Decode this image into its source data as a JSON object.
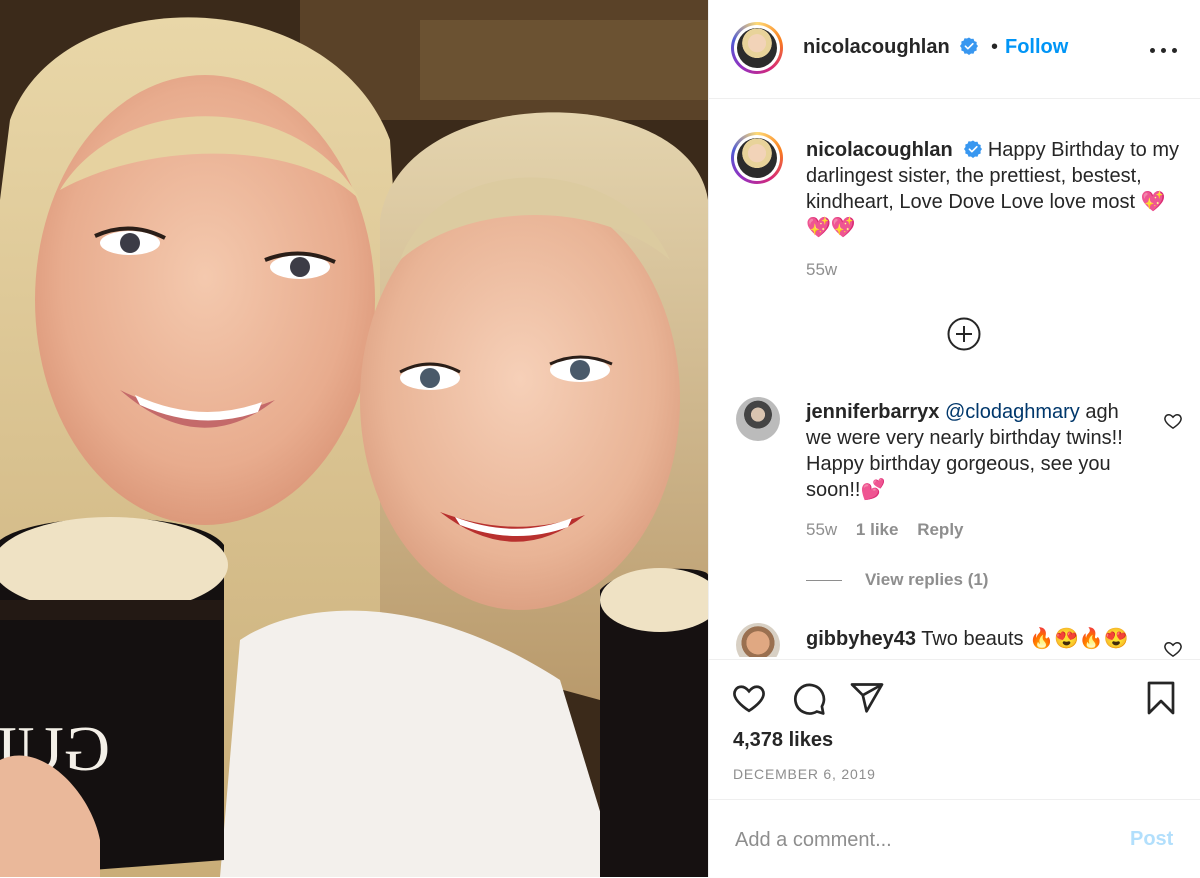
{
  "post": {
    "username": "nicolacoughlan",
    "follow_label": "Follow",
    "dot": "•",
    "caption": "Happy Birthday to my darlingest sister, the prettiest, bestest, kindheart, Love Dove Love love most 💖💖💖",
    "caption_time": "55w",
    "likes": "4,378 likes",
    "date": "DECEMBER 6, 2019"
  },
  "comments": [
    {
      "username": "jenniferbarryx",
      "mention": "@clodaghmary",
      "text": "agh we were very nearly birthday twins!! Happy birthday gorgeous, see you soon!!💕",
      "time": "55w",
      "likes": "1 like",
      "reply_label": "Reply",
      "view_replies": "View replies (1)"
    },
    {
      "username": "gibbyhey43",
      "text": "Two beauts 🔥😍🔥😍"
    }
  ],
  "composer": {
    "placeholder": "Add a comment...",
    "post_label": "Post"
  },
  "photo": {
    "glass_text": "GUI"
  },
  "colors": {
    "accent": "#0095f6",
    "post_disabled": "#b2dffc",
    "mention": "#00376b",
    "muted": "#8e8e8e"
  },
  "icons": [
    "verified-badge-icon",
    "more-options-icon",
    "add-comment-plus-icon",
    "heart-icon",
    "comment-icon",
    "share-icon",
    "bookmark-icon"
  ]
}
